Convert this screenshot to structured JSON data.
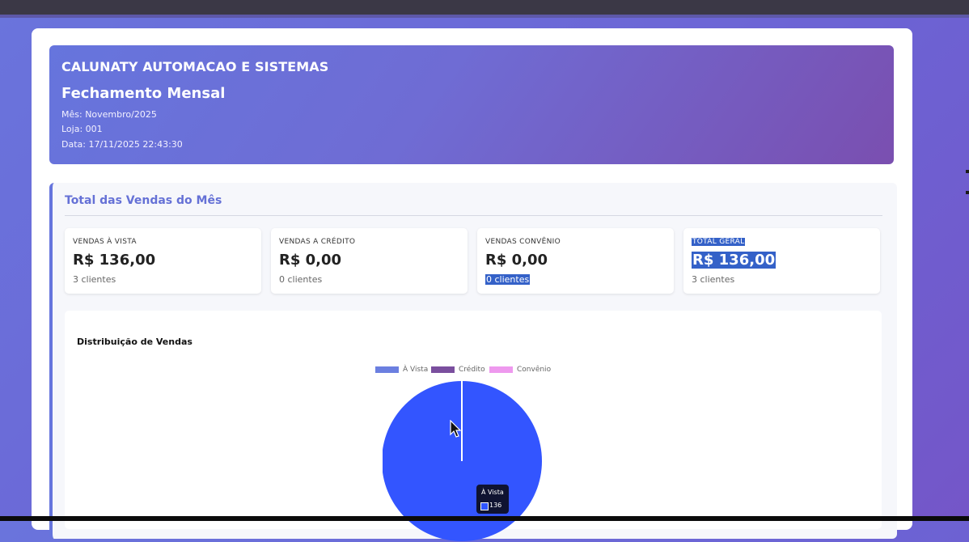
{
  "header": {
    "company": "CALUNATY AUTOMACAO E SISTEMAS",
    "title": "Fechamento Mensal",
    "month": "Mês: Novembro/2025",
    "store": "Loja: 001",
    "date": "Data: 17/11/2025 22:43:30"
  },
  "section": {
    "title": "Total das Vendas do Mês"
  },
  "cards": [
    {
      "label": "VENDAS À VISTA",
      "value": "R$ 136,00",
      "sub": "3 clientes"
    },
    {
      "label": "VENDAS A CRÉDITO",
      "value": "R$ 0,00",
      "sub": "0 clientes"
    },
    {
      "label": "VENDAS CONVÊNIO",
      "value": "R$ 0,00",
      "sub": "0 clientes"
    },
    {
      "label": "TOTAL GERAL",
      "value": "R$ 136,00",
      "sub": "3 clientes"
    }
  ],
  "chart": {
    "title": "Distribuição de Vendas",
    "tooltip": {
      "label": "À Vista",
      "value": "136"
    }
  },
  "chart_data": {
    "type": "pie",
    "title": "Distribuição de Vendas",
    "categories": [
      "À Vista",
      "Crédito",
      "Convênio"
    ],
    "values": [
      136,
      0,
      0
    ],
    "colors": [
      "#6b7fe0",
      "#7a4f9e",
      "#ee99ee"
    ],
    "slice_color": "#3355ff",
    "legend_position": "top"
  },
  "colors": {
    "accent": "#6675dd",
    "header_gradient_end": "#7a4fb0",
    "selection": "#3461c8"
  }
}
